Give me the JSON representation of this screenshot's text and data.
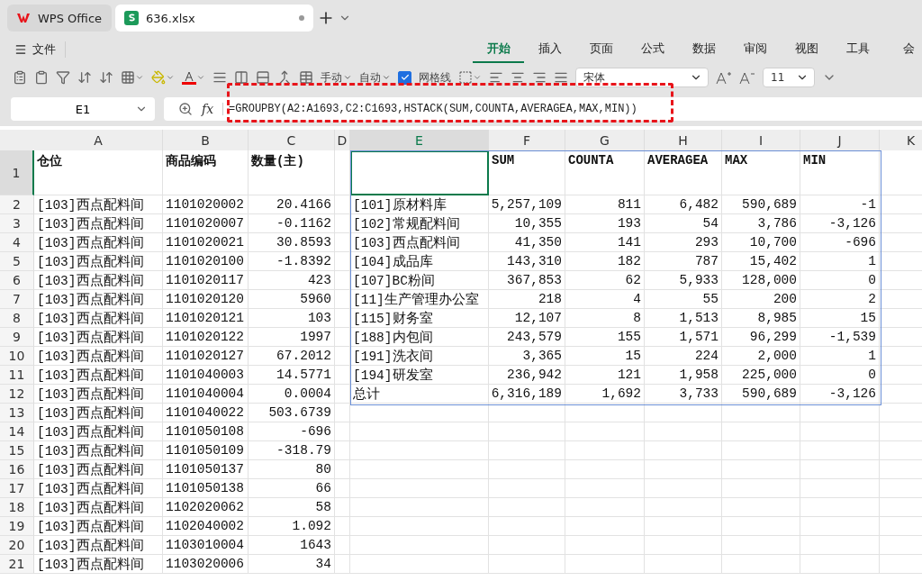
{
  "app_tabs": [
    {
      "label": "WPS Office",
      "kind": "home",
      "selected": false
    },
    {
      "label": "636.xlsx",
      "kind": "doc",
      "selected": true
    }
  ],
  "file_menu": "文件",
  "ribbon_tabs": [
    {
      "label": "开始",
      "selected": true
    },
    {
      "label": "插入",
      "selected": false
    },
    {
      "label": "页面",
      "selected": false
    },
    {
      "label": "公式",
      "selected": false
    },
    {
      "label": "数据",
      "selected": false
    },
    {
      "label": "审阅",
      "selected": false
    },
    {
      "label": "视图",
      "selected": false
    },
    {
      "label": "工具",
      "selected": false
    },
    {
      "label": "会",
      "selected": false
    }
  ],
  "toolbar": {
    "manual": "手动",
    "auto": "自动",
    "gridlines": {
      "label": "网格线",
      "checked": true
    },
    "font": "宋体",
    "font_size": "11"
  },
  "name_box": "E1",
  "function_label": "fx",
  "formula": "=GROUPBY(A2:A1693,C2:C1693,HSTACK(SUM,COUNTA,AVERAGEA,MAX,MIN))",
  "columns": [
    {
      "label": "A",
      "selected": false
    },
    {
      "label": "B",
      "selected": false
    },
    {
      "label": "C",
      "selected": false
    },
    {
      "label": "D",
      "selected": false
    },
    {
      "label": "E",
      "selected": true
    },
    {
      "label": "F",
      "selected": false
    },
    {
      "label": "G",
      "selected": false
    },
    {
      "label": "H",
      "selected": false
    },
    {
      "label": "I",
      "selected": false
    },
    {
      "label": "J",
      "selected": false
    },
    {
      "label": "K",
      "selected": false
    }
  ],
  "rows": [
    {
      "num": "1",
      "selected": true,
      "cells": [
        "仓位",
        "商品编码",
        "数量(主)",
        "",
        "",
        "SUM",
        "COUNTA",
        "AVERAGEA",
        "MAX",
        "MIN",
        ""
      ]
    },
    {
      "num": "2",
      "selected": false,
      "cells": [
        "[103]西点配料间",
        "1101020002",
        "20.4166",
        "",
        "[101]原材料库",
        "5,257,109",
        "811",
        "6,482",
        "590,689",
        "-1",
        ""
      ]
    },
    {
      "num": "3",
      "selected": false,
      "cells": [
        "[103]西点配料间",
        "1101020007",
        "-0.1162",
        "",
        "[102]常规配料间",
        "10,355",
        "193",
        "54",
        "3,786",
        "-3,126",
        ""
      ]
    },
    {
      "num": "4",
      "selected": false,
      "cells": [
        "[103]西点配料间",
        "1101020021",
        "30.8593",
        "",
        "[103]西点配料间",
        "41,350",
        "141",
        "293",
        "10,700",
        "-696",
        ""
      ]
    },
    {
      "num": "5",
      "selected": false,
      "cells": [
        "[103]西点配料间",
        "1101020100",
        "-1.8392",
        "",
        "[104]成品库",
        "143,310",
        "182",
        "787",
        "15,402",
        "1",
        ""
      ]
    },
    {
      "num": "6",
      "selected": false,
      "cells": [
        "[103]西点配料间",
        "1101020117",
        "423",
        "",
        "[107]BC粉间",
        "367,853",
        "62",
        "5,933",
        "128,000",
        "0",
        ""
      ]
    },
    {
      "num": "7",
      "selected": false,
      "cells": [
        "[103]西点配料间",
        "1101020120",
        "5960",
        "",
        "[11]生产管理办公室",
        "218",
        "4",
        "55",
        "200",
        "2",
        ""
      ]
    },
    {
      "num": "8",
      "selected": false,
      "cells": [
        "[103]西点配料间",
        "1101020121",
        "103",
        "",
        "[115]财务室",
        "12,107",
        "8",
        "1,513",
        "8,985",
        "15",
        ""
      ]
    },
    {
      "num": "9",
      "selected": false,
      "cells": [
        "[103]西点配料间",
        "1101020122",
        "1997",
        "",
        "[188]内包间",
        "243,579",
        "155",
        "1,571",
        "96,299",
        "-1,539",
        ""
      ]
    },
    {
      "num": "10",
      "selected": false,
      "cells": [
        "[103]西点配料间",
        "1101020127",
        "67.2012",
        "",
        "[191]洗衣间",
        "3,365",
        "15",
        "224",
        "2,000",
        "1",
        ""
      ]
    },
    {
      "num": "11",
      "selected": false,
      "cells": [
        "[103]西点配料间",
        "1101040003",
        "14.5771",
        "",
        "[194]研发室",
        "236,942",
        "121",
        "1,958",
        "225,000",
        "0",
        ""
      ]
    },
    {
      "num": "12",
      "selected": false,
      "cells": [
        "[103]西点配料间",
        "1101040004",
        "0.0004",
        "",
        "总计",
        "6,316,189",
        "1,692",
        "3,733",
        "590,689",
        "-3,126",
        ""
      ]
    },
    {
      "num": "13",
      "selected": false,
      "cells": [
        "[103]西点配料间",
        "1101040022",
        "503.6739",
        "",
        "",
        "",
        "",
        "",
        "",
        "",
        ""
      ]
    },
    {
      "num": "14",
      "selected": false,
      "cells": [
        "[103]西点配料间",
        "1101050108",
        "-696",
        "",
        "",
        "",
        "",
        "",
        "",
        "",
        ""
      ]
    },
    {
      "num": "15",
      "selected": false,
      "cells": [
        "[103]西点配料间",
        "1101050109",
        "-318.79",
        "",
        "",
        "",
        "",
        "",
        "",
        "",
        ""
      ]
    },
    {
      "num": "16",
      "selected": false,
      "cells": [
        "[103]西点配料间",
        "1101050137",
        "80",
        "",
        "",
        "",
        "",
        "",
        "",
        "",
        ""
      ]
    },
    {
      "num": "17",
      "selected": false,
      "cells": [
        "[103]西点配料间",
        "1101050138",
        "66",
        "",
        "",
        "",
        "",
        "",
        "",
        "",
        ""
      ]
    },
    {
      "num": "18",
      "selected": false,
      "cells": [
        "[103]西点配料间",
        "1102020062",
        "58",
        "",
        "",
        "",
        "",
        "",
        "",
        "",
        ""
      ]
    },
    {
      "num": "19",
      "selected": false,
      "cells": [
        "[103]西点配料间",
        "1102040002",
        "1.092",
        "",
        "",
        "",
        "",
        "",
        "",
        "",
        ""
      ]
    },
    {
      "num": "20",
      "selected": false,
      "cells": [
        "[103]西点配料间",
        "1103010004",
        "1643",
        "",
        "",
        "",
        "",
        "",
        "",
        "",
        ""
      ]
    },
    {
      "num": "21",
      "selected": false,
      "cells": [
        "[103]西点配料间",
        "1103020006",
        "34",
        "",
        "",
        "",
        "",
        "",
        "",
        "",
        ""
      ]
    }
  ]
}
